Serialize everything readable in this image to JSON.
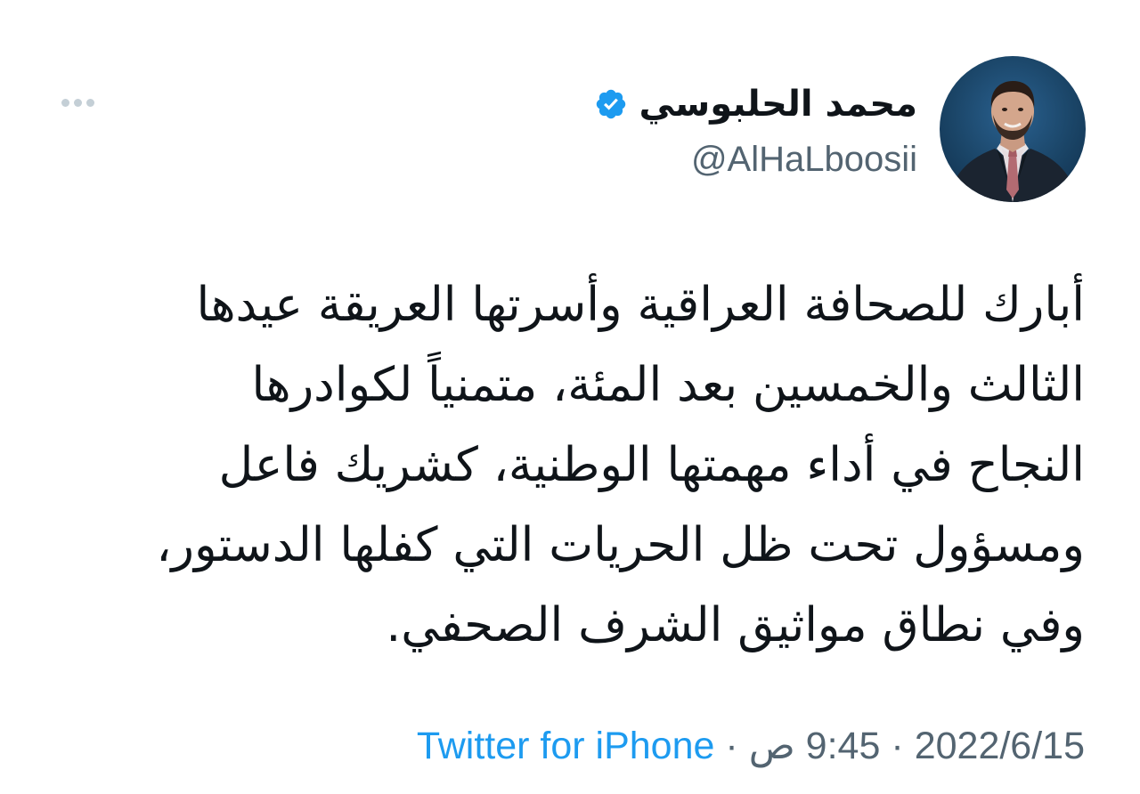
{
  "tweet": {
    "author": {
      "display_name": "محمد الحلبوسي",
      "handle": "@AlHaLboosii",
      "verified_icon": "verified-badge-icon",
      "avatar_icon": "profile-avatar"
    },
    "more_icon": "more-options-icon",
    "text_lines": [
      "أبارك للصحافة العراقية وأسرتها العريقة عيدها",
      "الثالث والخمسين بعد المئة، متمنياً لكوادرها",
      "النجاح في أداء مهمتها الوطنية، كشريك فاعل",
      "ومسؤول تحت ظل الحريات التي كفلها الدستور،",
      "وفي نطاق مواثيق الشرف الصحفي."
    ],
    "meta": {
      "date": "2022/6/15",
      "separator": "·",
      "time": "9:45 ص",
      "source": "Twitter for iPhone"
    }
  },
  "colors": {
    "text": "#0f1419",
    "secondary": "#536471",
    "accent": "#1d9bf0",
    "dots": "#c4cfd6"
  }
}
